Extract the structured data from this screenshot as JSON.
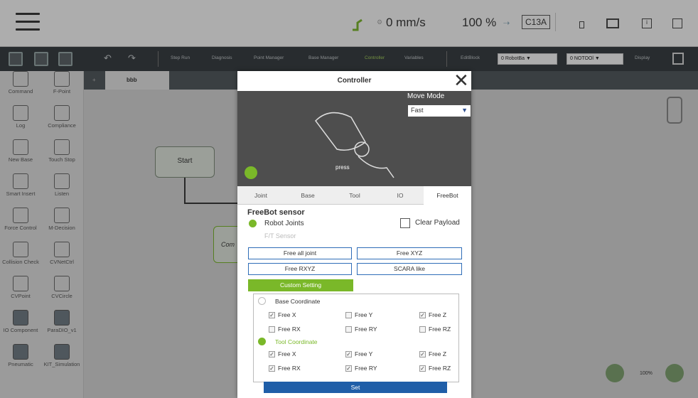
{
  "status": {
    "speed": "0 mm/s",
    "percent": "100 %",
    "code": "C13A"
  },
  "toolbar": {
    "items": [
      "Step Run",
      "Diagnosis",
      "Point Manager",
      "Base Manager",
      "Controller",
      "Variables",
      "EditBlock"
    ],
    "robot_base": "0 RobotBa",
    "tool": "0 NOTOOl",
    "display": "Display"
  },
  "left": {
    "items": [
      {
        "label": "Command",
        "icon": "command-icon"
      },
      {
        "label": "F-Point",
        "icon": "f-point-icon"
      },
      {
        "label": "Log",
        "icon": "log-icon"
      },
      {
        "label": "Compliance",
        "icon": "compliance-icon"
      },
      {
        "label": "New Base",
        "icon": "new-base-icon"
      },
      {
        "label": "Touch Stop",
        "icon": "touch-stop-icon"
      },
      {
        "label": "Smart Insert",
        "icon": "smart-insert-icon"
      },
      {
        "label": "Listen",
        "icon": "listen-icon"
      },
      {
        "label": "Force Control",
        "icon": "force-control-icon"
      },
      {
        "label": "M-Decision",
        "icon": "m-decision-icon"
      },
      {
        "label": "Collision Check",
        "icon": "collision-check-icon"
      },
      {
        "label": "CVNetCtrl",
        "icon": "cvnetctrl-icon"
      },
      {
        "label": "CVPoint",
        "icon": "cvpoint-icon"
      },
      {
        "label": "CVCircle",
        "icon": "cvcircle-icon"
      },
      {
        "label": "IO Component",
        "icon": "io-component-icon"
      },
      {
        "label": "ParaDIO_v1",
        "icon": "paradio-icon"
      },
      {
        "label": "Pneumatic",
        "icon": "pneumatic-icon"
      },
      {
        "label": "KIT_Simulation",
        "icon": "kit-simulation-icon"
      }
    ]
  },
  "canvas": {
    "tab": "bbb",
    "start_label": "Start",
    "node_label": "Com",
    "zoom": "100%"
  },
  "modal": {
    "title": "Controller",
    "move_mode_label": "Move Mode",
    "move_mode_value": "Fast",
    "press_label": "press",
    "tabs": [
      "Joint",
      "Base",
      "Tool",
      "IO",
      "FreeBot"
    ],
    "active_tab": 4,
    "section_title": "FreeBot sensor",
    "robot_joints": "Robot Joints",
    "ft_sensor": "F/T Sensor",
    "clear_payload": "Clear Payload",
    "buttons": [
      "Free all joint",
      "Free XYZ",
      "Free RXYZ",
      "SCARA like"
    ],
    "custom_setting": "Custom Setting",
    "base_coordinate": "Base Coordinate",
    "tool_coordinate": "Tool Coordinate",
    "base_checks": [
      {
        "label": "Free X",
        "checked": true
      },
      {
        "label": "Free Y",
        "checked": false
      },
      {
        "label": "Free Z",
        "checked": true
      },
      {
        "label": "Free RX",
        "checked": false
      },
      {
        "label": "Free RY",
        "checked": false
      },
      {
        "label": "Free RZ",
        "checked": false
      }
    ],
    "tool_checks": [
      {
        "label": "Free X",
        "checked": true
      },
      {
        "label": "Free Y",
        "checked": true
      },
      {
        "label": "Free Z",
        "checked": true
      },
      {
        "label": "Free RX",
        "checked": true
      },
      {
        "label": "Free RY",
        "checked": true
      },
      {
        "label": "Free RZ",
        "checked": true
      }
    ],
    "set_label": "Set"
  },
  "colors": {
    "accent": "#7ab829",
    "primary": "#2f6db8",
    "toolbar": "#333a3e"
  }
}
